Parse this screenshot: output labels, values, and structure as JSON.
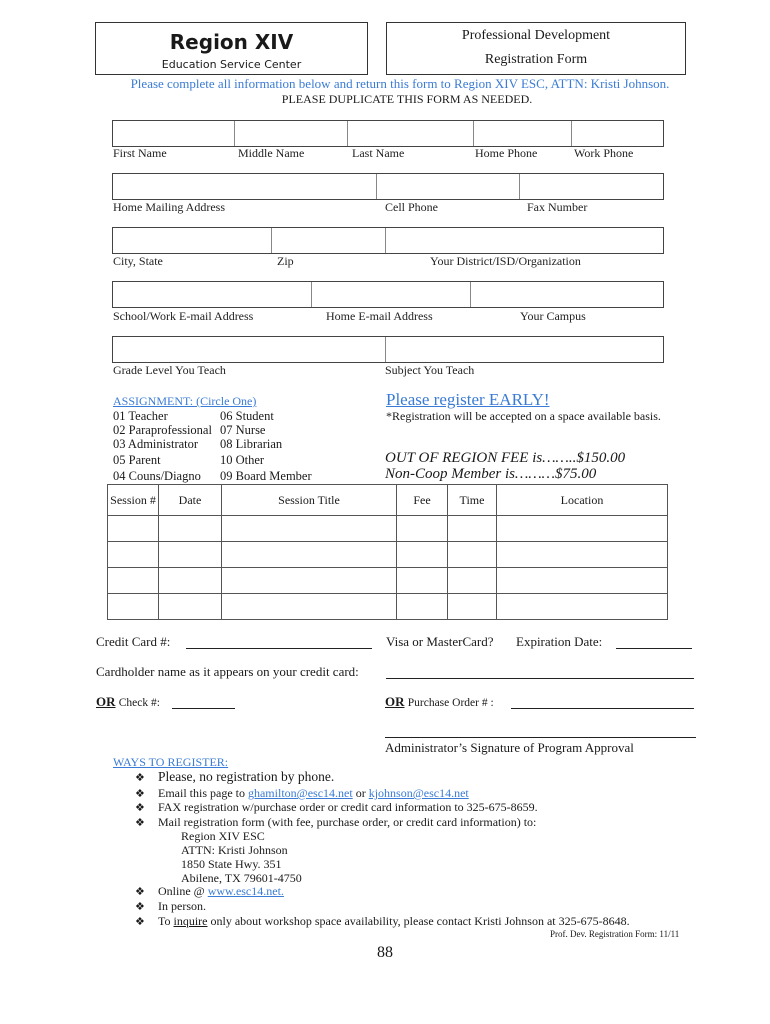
{
  "header": {
    "org_name": "Region XIV",
    "org_subtitle": "Education Service Center",
    "form_title_line1": "Professional Development",
    "form_title_line2": "Registration Form"
  },
  "instructions": "Please complete all information below and return this form to Region XIV ESC, ATTN:  Kristi Johnson.",
  "duplicate_notice": "PLEASE DUPLICATE THIS FORM AS NEEDED.",
  "fields": {
    "first_name": "First Name",
    "middle_name": "Middle Name",
    "last_name": "Last Name",
    "home_phone": "Home Phone",
    "work_phone": "Work Phone",
    "home_address": "Home Mailing Address",
    "cell_phone": "Cell Phone",
    "fax_number": "Fax Number",
    "city_state": "City, State",
    "zip": "Zip",
    "district": "Your District/ISD/Organization",
    "school_email": "School/Work E-mail Address",
    "home_email": "Home E-mail Address",
    "campus": "Your Campus",
    "grade_level": "Grade Level You Teach",
    "subject": "Subject You Teach"
  },
  "assignment": {
    "title": "ASSIGNMENT:  (Circle One)",
    "col1": [
      "01 Teacher",
      "02 Paraprofessional",
      "03 Administrator",
      "05 Parent",
      "04 Couns/Diagno"
    ],
    "col2": [
      "06 Student",
      "07 Nurse",
      "08 Librarian",
      "10 Other",
      "09 Board Member"
    ]
  },
  "early": {
    "title": "Please register EARLY!",
    "note": "*Registration will be accepted on a space available basis."
  },
  "fees": {
    "out_of_region": "OUT OF REGION FEE is……..$150.00",
    "non_coop": "Non-Coop Member is………$75.00"
  },
  "sessions": {
    "headers": [
      "Session #",
      "Date",
      "Session Title",
      "Fee",
      "Time",
      "Location"
    ],
    "rows": [
      [
        "",
        "",
        "",
        "",
        "",
        ""
      ],
      [
        "",
        "",
        "",
        "",
        "",
        ""
      ],
      [
        "",
        "",
        "",
        "",
        "",
        ""
      ],
      [
        "",
        "",
        "",
        "",
        "",
        ""
      ]
    ]
  },
  "payment": {
    "credit_card": "Credit Card #:",
    "visa_mc": "Visa or MasterCard?",
    "expiration": "Expiration Date:",
    "cardholder": "Cardholder name as it appears on your credit card:",
    "or_label": "OR",
    "check": "Check #:",
    "po": "Purchase Order # :",
    "signature": "Administrator’s Signature of Program Approval"
  },
  "ways": {
    "title": "WAYS TO REGISTER:",
    "no_phone": "Please, no registration by phone.",
    "email_prefix": "Email this page to ",
    "email1": "ghamilton@esc14.net",
    "email_or": " or ",
    "email2": "kjohnson@esc14.net",
    "fax": "FAX registration w/purchase order or credit card information to 325-675-8659.",
    "mail": "Mail registration form (with fee, purchase order, or credit card information) to:",
    "address": [
      "Region XIV ESC",
      "ATTN:  Kristi Johnson",
      "1850 State Hwy. 351",
      "Abilene, TX  79601-4750"
    ],
    "online_prefix": "Online @ ",
    "online_link": "www.esc14.net.",
    "in_person": "In person.",
    "inquire_prefix": "To ",
    "inquire_word": "inquire",
    "inquire_suffix": " only about workshop space availability, please contact Kristi Johnson at 325-675-8648.",
    "bullet_icon": "❖"
  },
  "footer": {
    "form_ref": "Prof. Dev. Registration Form:  11/11",
    "page_number": "88"
  },
  "colors": {
    "accent_blue": "#3a7bd5"
  }
}
